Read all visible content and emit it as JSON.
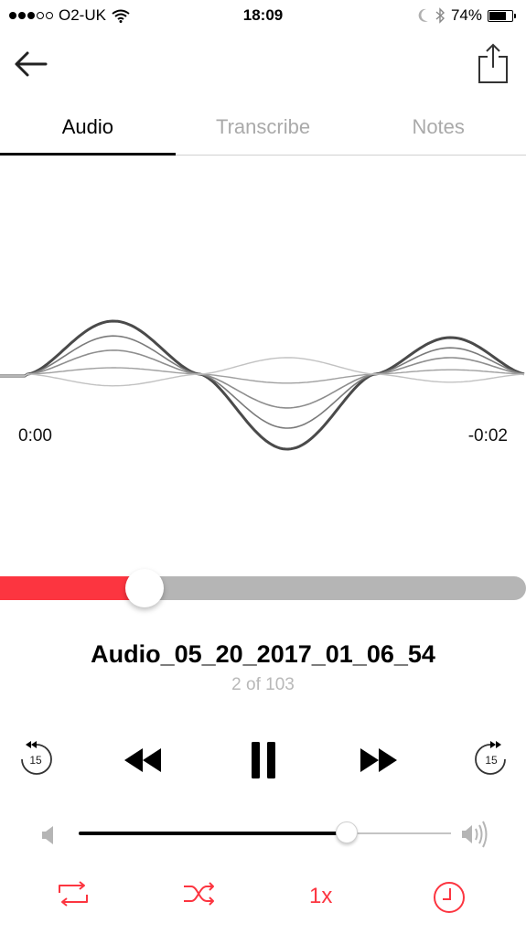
{
  "status_bar": {
    "carrier": "O2-UK",
    "signal_bars_filled": 3,
    "signal_bars_total": 5,
    "time": "18:09",
    "battery": "74%",
    "battery_level": 0.74,
    "icons": [
      "wifi-icon",
      "moon-icon",
      "bluetooth-icon",
      "battery-icon"
    ]
  },
  "nav": {
    "back_icon": "arrow-left-icon",
    "share_icon": "share-icon"
  },
  "tabs": [
    {
      "label": "Audio",
      "active": true
    },
    {
      "label": "Transcribe",
      "active": false
    },
    {
      "label": "Notes",
      "active": false
    }
  ],
  "player": {
    "elapsed": "0:00",
    "remaining": "-0:02",
    "progress": 0.275,
    "title": "Audio_05_20_2017_01_06_54",
    "position_text": "2 of 103",
    "volume": 0.72,
    "speed_label": "1x"
  },
  "transport": {
    "skip_back_label": "15",
    "skip_forward_label": "15",
    "icons": [
      "skip-back-15-icon",
      "rewind-icon",
      "pause-icon",
      "fast-forward-icon",
      "skip-forward-15-icon"
    ]
  },
  "options": {
    "icons": [
      "repeat-icon",
      "shuffle-icon",
      "playback-speed",
      "sleep-timer-icon"
    ]
  },
  "colors": {
    "accent": "#fc3540",
    "progress_track": "#b5b5b5",
    "inactive_tab": "#aaaaaa",
    "wave_dark": "#505050"
  }
}
